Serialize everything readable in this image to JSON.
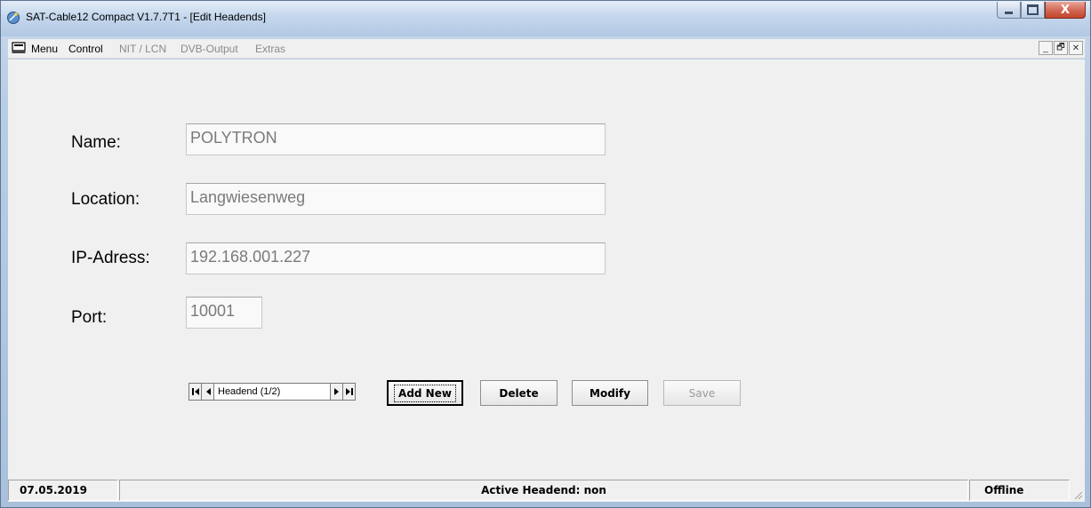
{
  "window": {
    "title": "SAT-Cable12 Compact V1.7.7T1 - [Edit Headends]",
    "app_icon": "satellite-dish-icon",
    "controls": {
      "minimize_icon": "minimize-icon",
      "maximize_icon": "maximize-icon",
      "close_icon": "close-icon",
      "close_label": "X"
    }
  },
  "menubar": {
    "icon": "menu-app-icon",
    "items": [
      {
        "label": "Menu",
        "enabled": true
      },
      {
        "label": "Control",
        "enabled": true
      },
      {
        "label": "NIT / LCN",
        "enabled": false
      },
      {
        "label": "DVB-Output",
        "enabled": false
      },
      {
        "label": "Extras",
        "enabled": false
      }
    ],
    "mdi": {
      "minimize_label": "_",
      "restore_label": "🗗",
      "close_label": "✕"
    }
  },
  "form": {
    "name": {
      "label": "Name:",
      "value": "POLYTRON"
    },
    "location": {
      "label": "Location:",
      "value": "Langwiesenweg"
    },
    "ip": {
      "label": "IP-Adress:",
      "value": "192.168.001.227"
    },
    "port": {
      "label": "Port:",
      "value": "10001"
    }
  },
  "navigator": {
    "label": "Headend (1/2)",
    "first_icon": "first-record-icon",
    "prev_icon": "prev-record-icon",
    "next_icon": "next-record-icon",
    "last_icon": "last-record-icon"
  },
  "buttons": {
    "add_new": "Add New",
    "delete": "Delete",
    "modify": "Modify",
    "save": "Save"
  },
  "statusbar": {
    "date": "07.05.2019",
    "center": "Active Headend: non",
    "status": "Offline"
  }
}
